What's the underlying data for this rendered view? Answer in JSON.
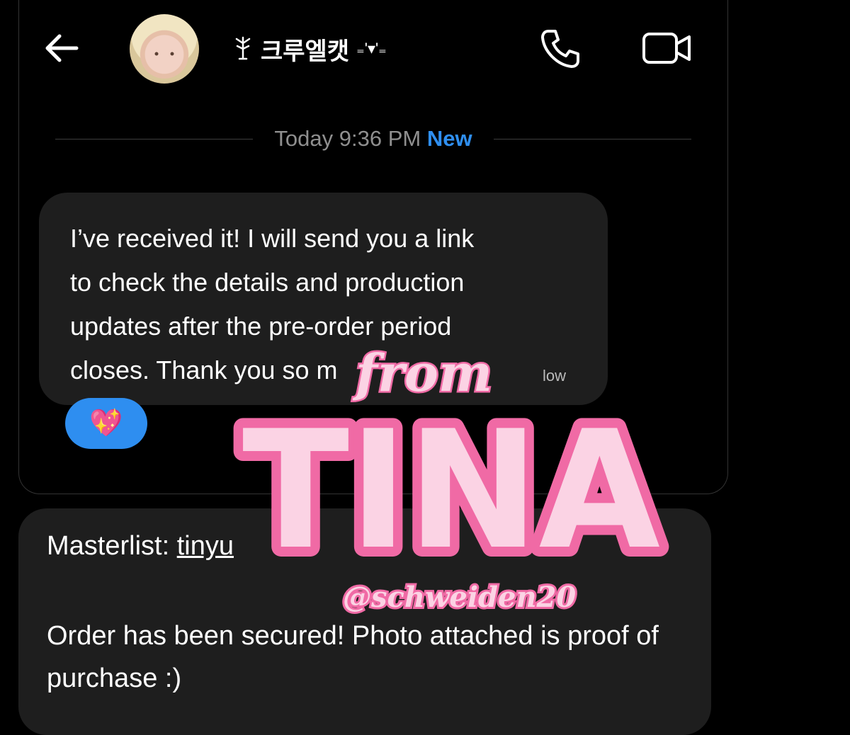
{
  "header": {
    "back_icon": "arrow-left-icon",
    "contact_name": "크루엘캣",
    "name_prefix_icon": "sparkle-flower-icon",
    "name_suffix": "₌'▾'₌",
    "call_icon": "phone-icon",
    "video_icon": "video-camera-icon"
  },
  "separator": {
    "time": "Today 9:36 PM",
    "new_label": "New"
  },
  "message1": {
    "text": "I’ve received it! I will send you a link\nto check the details and production\nupdates after the pre-order period\ncloses. Thank you so m",
    "timestamp_fragment": "low"
  },
  "reaction": {
    "emoji": "💖"
  },
  "message2": {
    "master_label": "Masterlist: ",
    "link_fragment": "tinyu",
    "order_text": "Order has been secured! Photo attached is proof of purchase :)"
  },
  "watermark": {
    "from": "from",
    "name": "TINA",
    "handle": "@schweiden20"
  },
  "colors": {
    "accent_blue": "#2f8ff0",
    "bubble": "#1e1e1e",
    "watermark_pink": "#f06aa5",
    "watermark_fill": "#fbd3e4"
  }
}
